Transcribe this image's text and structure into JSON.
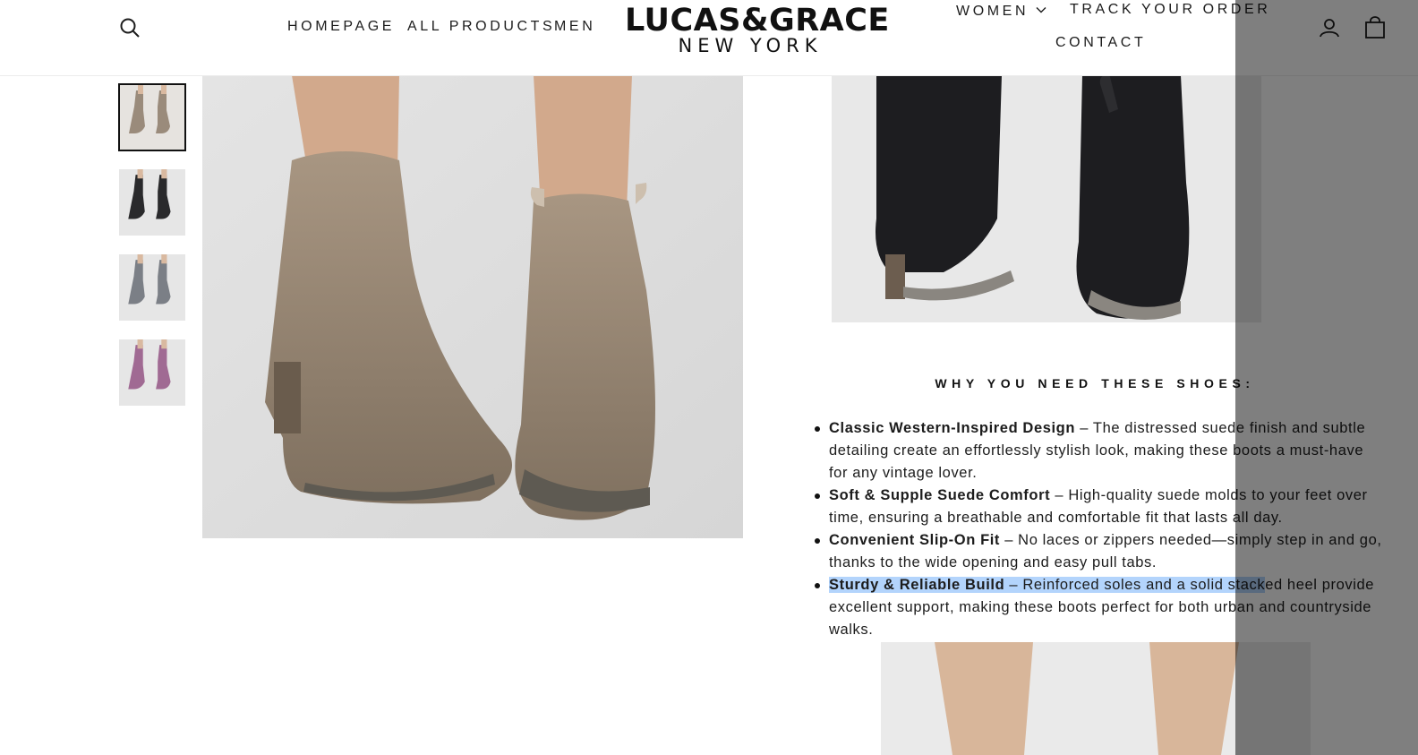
{
  "nav": {
    "homepage": "HOMEPAGE",
    "all_products": "ALL PRODUCTS",
    "men": "MEN",
    "women": "WOMEN",
    "track_order": "TRACK YOUR ORDER",
    "contact": "CONTACT"
  },
  "logo": {
    "main": "LUCAS&GRACE",
    "sub": "NEW YORK"
  },
  "icons": {
    "search": "search-icon",
    "account": "user-icon",
    "cart": "bag-icon",
    "women_dropdown": "chevron-down-icon"
  },
  "gallery": {
    "thumbnails": [
      {
        "color_name": "taupe",
        "color": "#9a8b7b",
        "active": true
      },
      {
        "color_name": "black",
        "color": "#2a2a2c",
        "active": false
      },
      {
        "color_name": "grey",
        "color": "#7b7f86",
        "active": false
      },
      {
        "color_name": "pink",
        "color": "#a06a93",
        "active": false
      }
    ]
  },
  "description": {
    "heading": "WHY YOU NEED THESE SHOES:",
    "features": [
      {
        "title": "Classic Western-Inspired Design",
        "text": " – The distressed suede finish and subtle detailing create an effortlessly stylish look, making these boots a must-have for any vintage lover."
      },
      {
        "title": "Soft & Supple Suede Comfort",
        "text": " – High-quality suede molds to your feet over time, ensuring a breathable and comfortable fit that lasts all day."
      },
      {
        "title": "Convenient Slip-On Fit",
        "text": " – No laces or zippers needed—simply step in and go, thanks to the wide opening and easy pull tabs."
      },
      {
        "title": "Sturdy & Reliable Build",
        "text_highlighted": " – Reinforced soles and a solid stack",
        "text": "ed heel provide excellent support, making these boots perfect for both urban and countryside walks."
      }
    ]
  },
  "colors": {
    "text": "#1c1c1c",
    "selection": "#b3d4fc",
    "overlay": "rgba(0,0,0,0.5)"
  }
}
